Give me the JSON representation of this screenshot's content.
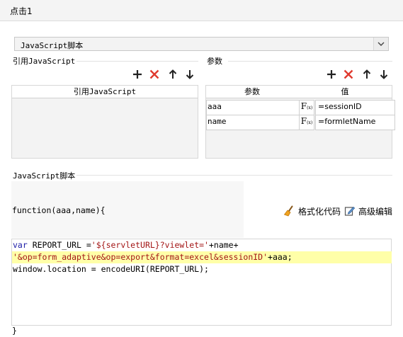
{
  "window": {
    "title": "点击1"
  },
  "script_type": {
    "selected": "JavaScript脚本"
  },
  "ref_section": {
    "title": "引用JavaScript",
    "column_header": "引用JavaScript"
  },
  "params_section": {
    "title": "参数",
    "columns": [
      "参数",
      "值"
    ],
    "rows": [
      {
        "name": "aaa",
        "value": "=sessionID"
      },
      {
        "name": "name",
        "value": "=formletName"
      }
    ]
  },
  "script_section": {
    "title": "JavaScript脚本",
    "function_header": "function(aaa,name){",
    "format_label": "格式化代码",
    "advanced_label": "高级编辑",
    "code": {
      "l1_kw": "var",
      "l1_a": " REPORT_URL =",
      "l1_str": "'${servletURL}?viewlet='",
      "l1_b": "+name+",
      "l2_str": "'&op=form_adaptive&op=export&format=excel&sessionID'",
      "l2_b": "+aaa;",
      "l3": "window.location = encodeURI(REPORT_URL);"
    },
    "closing_brace": "}"
  },
  "icons": [
    "add-icon",
    "delete-icon",
    "move-up-icon",
    "move-down-icon",
    "fx-formula-icon",
    "broom-icon",
    "edit-icon",
    "chevron-down-icon"
  ],
  "colors": {
    "delete": "#e03a2f",
    "keyword": "#1a1aa6",
    "string": "#a31515",
    "highlight": "#ffffa8"
  }
}
